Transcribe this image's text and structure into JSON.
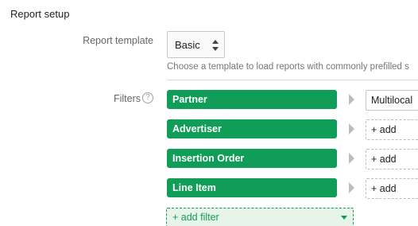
{
  "section": {
    "title": "Report setup"
  },
  "template": {
    "label": "Report template",
    "selected": "Basic",
    "helper": "Choose a template to load reports with commonly prefilled s"
  },
  "filters": {
    "label": "Filters",
    "help_glyph": "?",
    "rows": [
      {
        "name": "Partner",
        "value": "Multilocal",
        "is_add": false
      },
      {
        "name": "Advertiser",
        "value": "+ add",
        "is_add": true
      },
      {
        "name": "Insertion Order",
        "value": "+ add",
        "is_add": true
      },
      {
        "name": "Line Item",
        "value": "+ add",
        "is_add": true
      }
    ],
    "add_filter_label": "+ add filter"
  },
  "colors": {
    "accent": "#0f9d58",
    "add_filter_bg": "#e6f4ea"
  }
}
